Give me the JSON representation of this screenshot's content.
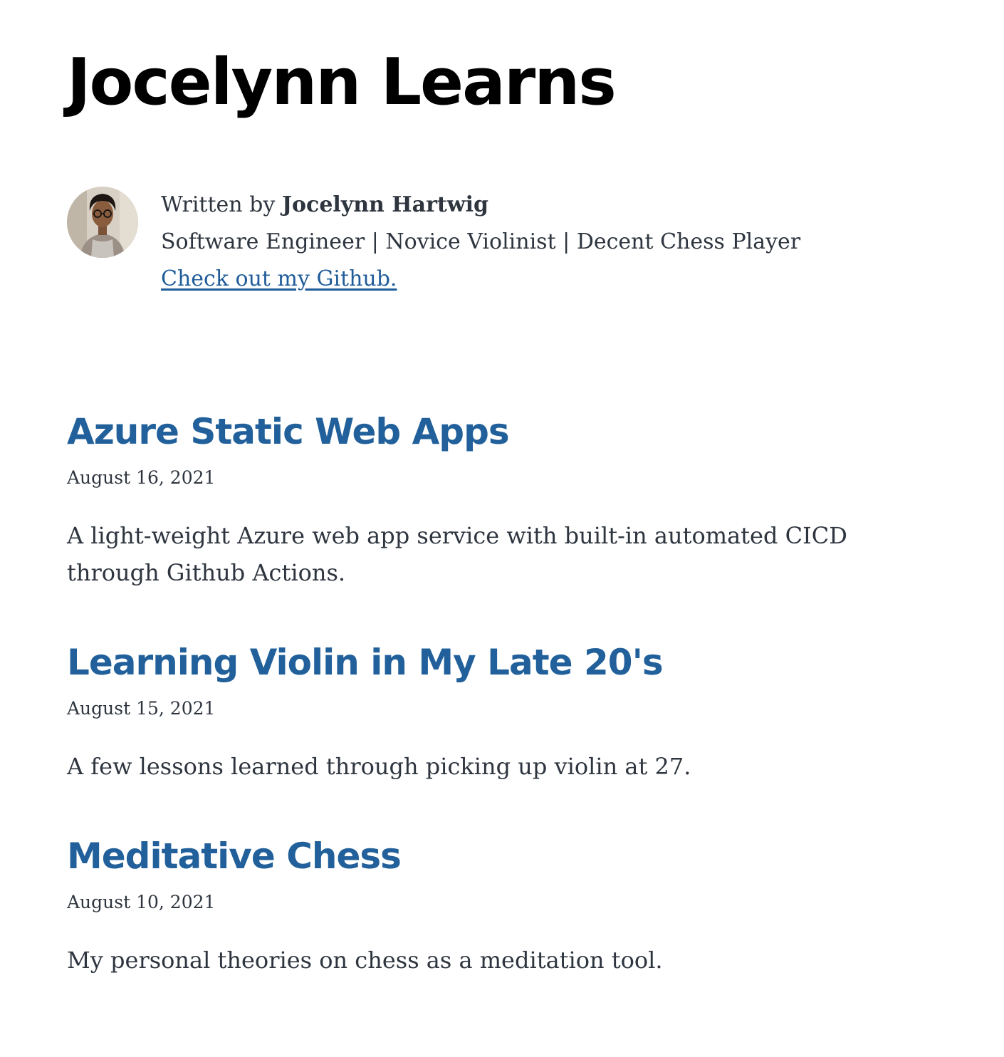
{
  "site": {
    "title": "Jocelynn Learns"
  },
  "bio": {
    "written_by_prefix": "Written by ",
    "author_name": "Jocelynn Hartwig",
    "tagline": "Software Engineer | Novice Violinist | Decent Chess Player",
    "github_link_text": "Check out my Github.",
    "avatar_icon": "author-photo"
  },
  "posts": [
    {
      "title": "Azure Static Web Apps",
      "date": "August 16, 2021",
      "excerpt": "A light-weight Azure web app service with built-in automated CICD through Github Actions."
    },
    {
      "title": "Learning Violin in My Late 20's",
      "date": "August 15, 2021",
      "excerpt": "A few lessons learned through picking up violin at 27."
    },
    {
      "title": "Meditative Chess",
      "date": "August 10, 2021",
      "excerpt": "My personal theories on chess as a meditation tool."
    }
  ],
  "colors": {
    "title": "#000000",
    "post_title": "#21609a",
    "link": "#1f5c99",
    "body_text": "#2e353f"
  }
}
